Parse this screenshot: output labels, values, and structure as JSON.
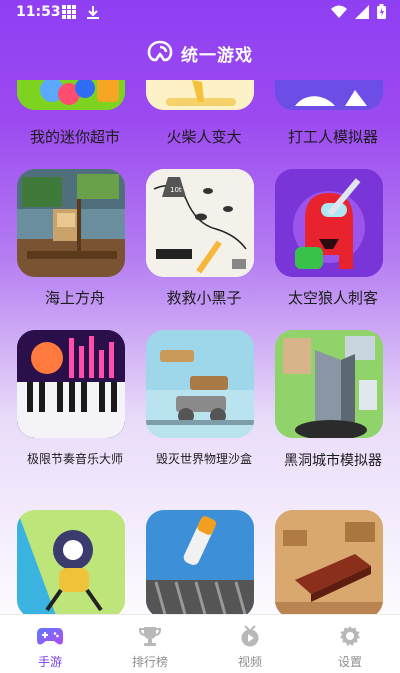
{
  "status_bar": {
    "time": "11:53",
    "left_icons": [
      "grid-icon",
      "download-icon"
    ],
    "right_icons": [
      "wifi-icon",
      "signal-icon",
      "battery-icon"
    ]
  },
  "header": {
    "title": "统一游戏",
    "logo": "app-logo-icon"
  },
  "games": [
    {
      "label": "我的迷你超市"
    },
    {
      "label": "火柴人变大"
    },
    {
      "label": "打工人模拟器"
    },
    {
      "label": "海上方舟"
    },
    {
      "label": "救救小黑子"
    },
    {
      "label": "太空狼人刺客"
    },
    {
      "label": "极限节奏音乐大师"
    },
    {
      "label": "毁灭世界物理沙盒"
    },
    {
      "label": "黑洞城市模拟器"
    },
    {
      "label": ""
    },
    {
      "label": ""
    },
    {
      "label": ""
    }
  ],
  "bottom_nav": [
    {
      "label": "手游",
      "icon": "gamepad-icon",
      "active": true
    },
    {
      "label": "排行榜",
      "icon": "trophy-icon",
      "active": false
    },
    {
      "label": "视频",
      "icon": "video-icon",
      "active": false
    },
    {
      "label": "设置",
      "icon": "gear-icon",
      "active": false
    }
  ],
  "colors": {
    "accent": "#7a3cf0",
    "header_bg": "#8f3ff2",
    "nav_inactive": "#8e8e8e"
  }
}
